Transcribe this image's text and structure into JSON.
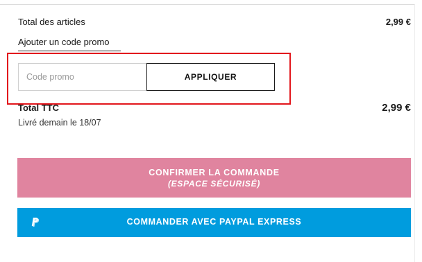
{
  "summary": {
    "total_articles_label": "Total des articles",
    "total_articles_value": "2,99 €"
  },
  "promo": {
    "link_label": "Ajouter un code promo",
    "input_placeholder": "Code promo",
    "apply_label": "APPLIQUER"
  },
  "total": {
    "label": "Total TTC",
    "value": "2,99 €",
    "delivery": "Livré demain le 18/07"
  },
  "actions": {
    "confirm_line1": "CONFIRMER LA COMMANDE",
    "confirm_line2": "(ESPACE SÉCURISÉ)",
    "paypal_label": "COMMANDER AVEC PAYPAL EXPRESS",
    "paypal_icon": "paypal-icon"
  },
  "colors": {
    "confirm_bg": "#e0849f",
    "paypal_bg": "#009cde",
    "highlight": "#e2161c"
  }
}
